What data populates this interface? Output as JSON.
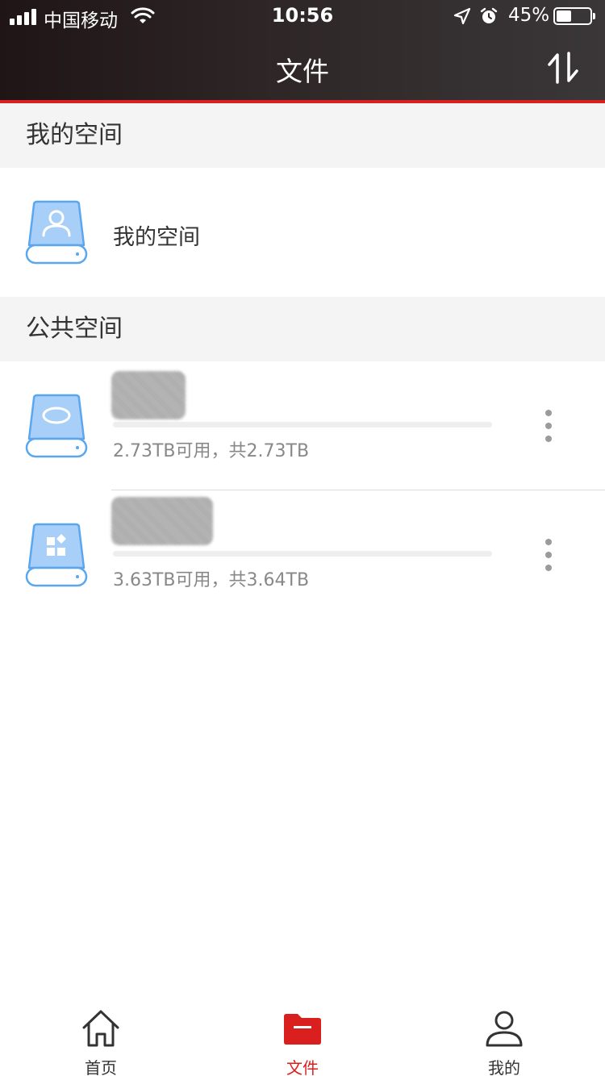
{
  "status_bar": {
    "carrier": "中国移动",
    "time": "10:56",
    "battery_percent": "45%",
    "battery_level": 0.45
  },
  "header": {
    "title": "文件",
    "sort_icon": "sort-toggle-icon"
  },
  "sections": {
    "my_space": {
      "title": "我的空间",
      "items": [
        {
          "label": "我的空间",
          "icon": "user-disk-icon"
        }
      ]
    },
    "public_space": {
      "title": "公共空间",
      "items": [
        {
          "name_redacted": true,
          "info": "2.73TB可用，共2.73TB",
          "icon": "disk-icon"
        },
        {
          "name_redacted": true,
          "info": "3.63TB可用，共3.64TB",
          "icon": "apps-disk-icon"
        }
      ]
    }
  },
  "tabbar": {
    "items": [
      {
        "label": "首页",
        "icon": "home-icon",
        "active": false
      },
      {
        "label": "文件",
        "icon": "folder-icon",
        "active": true
      },
      {
        "label": "我的",
        "icon": "person-icon",
        "active": false
      }
    ]
  },
  "colors": {
    "accent": "#d9201f",
    "disk_blue": "#9cc7f5",
    "disk_stroke": "#5aa6ef"
  }
}
